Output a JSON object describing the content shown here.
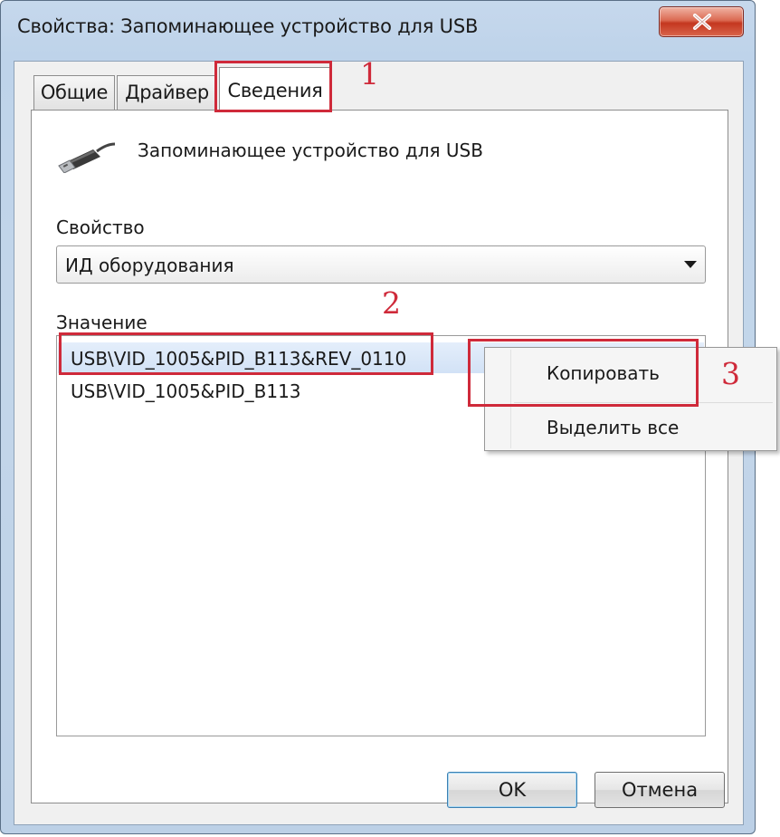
{
  "window": {
    "title": "Свойства: Запоминающее устройство для USB"
  },
  "tabs": [
    {
      "label": "Общие",
      "active": false
    },
    {
      "label": "Драйвер",
      "active": false
    },
    {
      "label": "Сведения",
      "active": true
    }
  ],
  "device": {
    "name": "Запоминающее устройство для USB",
    "icon": "usb-plug-icon"
  },
  "property": {
    "label": "Свойство",
    "selected": "ИД оборудования"
  },
  "value": {
    "label": "Значение",
    "items": [
      "USB\\VID_1005&PID_B113&REV_0110",
      "USB\\VID_1005&PID_B113"
    ]
  },
  "context_menu": {
    "copy": "Копировать",
    "select_all": "Выделить все"
  },
  "buttons": {
    "ok": "OK",
    "cancel": "Отмена"
  },
  "annotations": {
    "step1": "1",
    "step2": "2",
    "step3": "3",
    "color": "#cf2a3a"
  }
}
